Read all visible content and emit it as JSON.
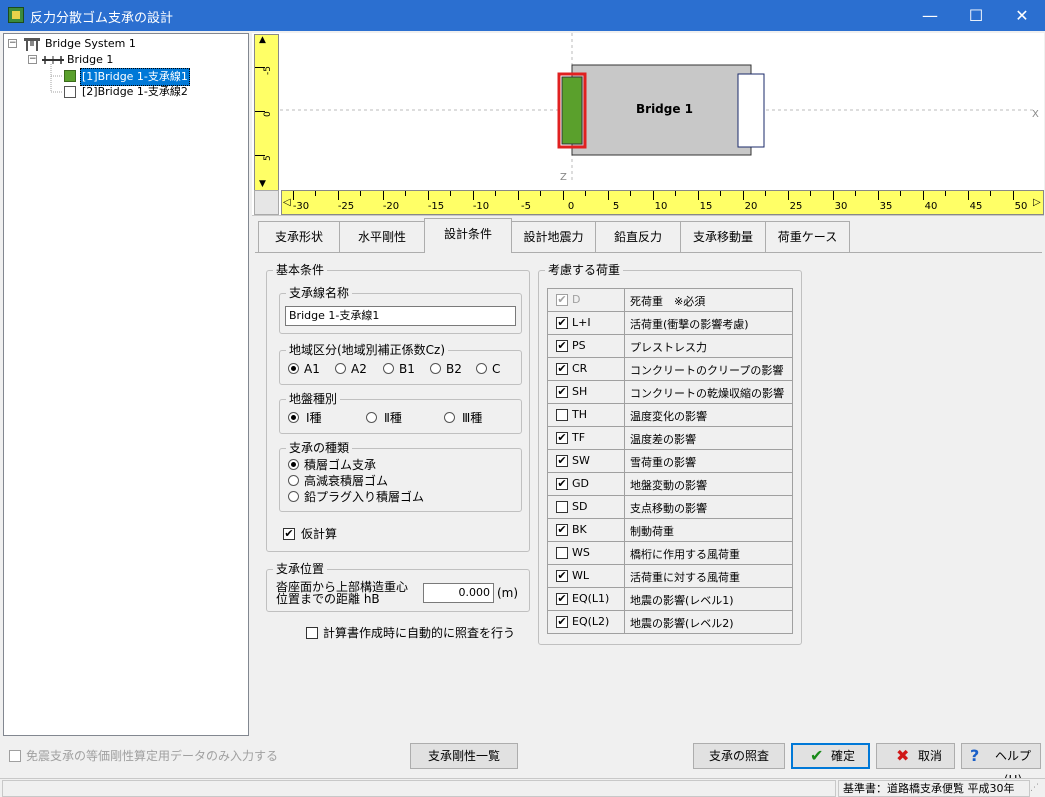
{
  "window": {
    "title": "反力分散ゴム支承の設計",
    "controls": {
      "minimize": "—",
      "maximize": "☐",
      "close": "✕"
    }
  },
  "tree": {
    "root": {
      "label": "Bridge System 1",
      "expander": "−"
    },
    "bridge": {
      "label": "Bridge 1",
      "expander": "−"
    },
    "items": [
      {
        "label": "[1]Bridge 1-支承線1",
        "selected": true,
        "color": "#5aa02c"
      },
      {
        "label": "[2]Bridge 1-支承線2",
        "selected": false,
        "color": "#ffffff"
      }
    ]
  },
  "drawing": {
    "bridge_label": "Bridge 1",
    "axis_x_label": "X",
    "axis_z_label": "Z",
    "colors": {
      "deck": "#c8c8c8",
      "bearing_selected": "#5aa02c",
      "selection_border": "#e02020",
      "ruler": "#ffff66"
    },
    "h_ticks": [
      "-30",
      "-25",
      "-20",
      "-15",
      "-10",
      "-5",
      "0",
      "5",
      "10",
      "15",
      "20",
      "25",
      "30",
      "35",
      "40",
      "45",
      "50"
    ],
    "v_ticks": [
      "-5",
      "0",
      "5"
    ]
  },
  "tabs": [
    {
      "label": "支承形状",
      "active": false
    },
    {
      "label": "水平剛性",
      "active": false
    },
    {
      "label": "設計条件",
      "active": true
    },
    {
      "label": "設計地震力",
      "active": false
    },
    {
      "label": "鉛直反力",
      "active": false
    },
    {
      "label": "支承移動量",
      "active": false
    },
    {
      "label": "荷重ケース",
      "active": false
    }
  ],
  "basic": {
    "legend": "基本条件",
    "line_name": {
      "legend": "支承線名称",
      "value": "Bridge 1-支承線1"
    },
    "region": {
      "legend": "地域区分(地域別補正係数Cz)",
      "options": [
        "A1",
        "A2",
        "B1",
        "B2",
        "C"
      ],
      "selected": "A1"
    },
    "ground": {
      "legend": "地盤種別",
      "options": [
        "Ⅰ種",
        "Ⅱ種",
        "Ⅲ種"
      ],
      "selected": "Ⅰ種"
    },
    "bearing_type": {
      "legend": "支承の種類",
      "options": [
        "積層ゴム支承",
        "高減衰積層ゴム",
        "鉛プラグ入り積層ゴム"
      ],
      "selected": "積層ゴム支承"
    },
    "provisional": {
      "label": "仮計算",
      "checked": true
    }
  },
  "position": {
    "legend": "支承位置",
    "label_line1": "沓座面から上部構造重心",
    "label_line2": "位置までの距離 hB",
    "value": "0.000",
    "unit": "(m)"
  },
  "auto_check": {
    "label": "計算書作成時に自動的に照査を行う",
    "checked": false
  },
  "loads": {
    "legend": "考慮する荷重",
    "rows": [
      {
        "code": "D",
        "name": "死荷重　※必須",
        "checked": true,
        "disabled": true
      },
      {
        "code": "L+I",
        "name": "活荷重(衝撃の影響考慮)",
        "checked": true,
        "disabled": false
      },
      {
        "code": "PS",
        "name": "プレストレス力",
        "checked": true,
        "disabled": false
      },
      {
        "code": "CR",
        "name": "コンクリートのクリープの影響",
        "checked": true,
        "disabled": false
      },
      {
        "code": "SH",
        "name": "コンクリートの乾燥収縮の影響",
        "checked": true,
        "disabled": false
      },
      {
        "code": "TH",
        "name": "温度変化の影響",
        "checked": false,
        "disabled": false
      },
      {
        "code": "TF",
        "name": "温度差の影響",
        "checked": true,
        "disabled": false
      },
      {
        "code": "SW",
        "name": "雪荷重の影響",
        "checked": true,
        "disabled": false
      },
      {
        "code": "GD",
        "name": "地盤変動の影響",
        "checked": true,
        "disabled": false
      },
      {
        "code": "SD",
        "name": "支点移動の影響",
        "checked": false,
        "disabled": false
      },
      {
        "code": "BK",
        "name": "制動荷重",
        "checked": true,
        "disabled": false
      },
      {
        "code": "WS",
        "name": "橋桁に作用する風荷重",
        "checked": false,
        "disabled": false
      },
      {
        "code": "WL",
        "name": "活荷重に対する風荷重",
        "checked": true,
        "disabled": false
      },
      {
        "code": "EQ(L1)",
        "name": "地震の影響(レベル1)",
        "checked": true,
        "disabled": false
      },
      {
        "code": "EQ(L2)",
        "name": "地震の影響(レベル2)",
        "checked": true,
        "disabled": false
      }
    ]
  },
  "bottom": {
    "isolation_only": {
      "label": "免震支承の等価剛性算定用データのみ入力する",
      "checked": false,
      "disabled": true
    },
    "stiffness_list": "支承剛性一覧",
    "check": "支承の照査",
    "ok": "確定",
    "cancel": "取消",
    "help": "ヘルプ(H)"
  },
  "status": {
    "standard": "基準書：道路橋支承便覧 平成30年"
  }
}
